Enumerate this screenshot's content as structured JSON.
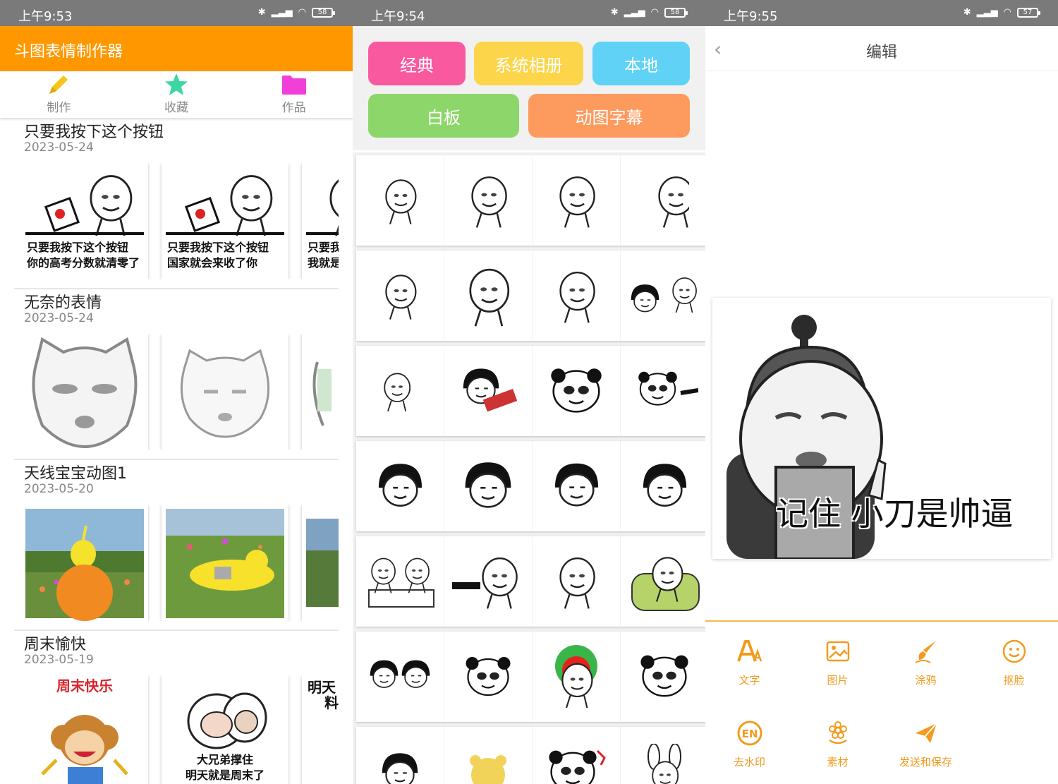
{
  "screens": [
    {
      "status": {
        "time": "上午9:53",
        "battery": "58"
      },
      "app_title": "斗图表情制作器",
      "tabs": [
        {
          "label": "制作",
          "icon": "pencil-icon"
        },
        {
          "label": "收藏",
          "icon": "star-icon"
        },
        {
          "label": "作品",
          "icon": "folder-icon"
        }
      ],
      "groups": [
        {
          "title": "只要我按下这个按钮",
          "date": "2023-05-24",
          "captions": [
            [
              "只要我按下这个按钮",
              "你的高考分数就清零了"
            ],
            [
              "只要我按下这个按钮",
              "国家就会来收了你"
            ],
            [
              "只要我",
              "我就是"
            ]
          ]
        },
        {
          "title": "无奈的表情",
          "date": "2023-05-24"
        },
        {
          "title": "天线宝宝动图1",
          "date": "2023-05-20"
        },
        {
          "title": "周末愉快",
          "date": "2023-05-19",
          "captions": [
            [
              "周末快乐"
            ],
            [
              "大兄弟撑住",
              "明天就是周末了"
            ],
            [
              "明天",
              "料"
            ]
          ]
        }
      ]
    },
    {
      "status": {
        "time": "上午9:54",
        "battery": "58"
      },
      "categories": [
        {
          "label": "经典",
          "color": "#f8599f"
        },
        {
          "label": "系统相册",
          "color": "#fcd54a"
        },
        {
          "label": "本地",
          "color": "#5fd2f6"
        },
        {
          "label": "白板",
          "color": "#8cd66a"
        },
        {
          "label": "动图字幕",
          "color": "#fd9a5d"
        }
      ]
    },
    {
      "status": {
        "time": "上午9:55",
        "battery": "57"
      },
      "title": "编辑",
      "overlay_text": "记住 小刀是帅逼",
      "tools": [
        {
          "label": "文字",
          "icon": "text-icon"
        },
        {
          "label": "图片",
          "icon": "image-icon"
        },
        {
          "label": "涂鸦",
          "icon": "brush-icon"
        },
        {
          "label": "抠脸",
          "icon": "face-icon"
        },
        {
          "label": "去水印",
          "icon": "watermark-icon"
        },
        {
          "label": "素材",
          "icon": "flower-icon"
        },
        {
          "label": "发送和保存",
          "icon": "send-icon"
        }
      ]
    }
  ],
  "colors": {
    "primary": "#ff9800",
    "tool": "#f29b1d",
    "pencil": "#f5c518",
    "star": "#3dd6a0",
    "folder": "#f13fd8"
  }
}
